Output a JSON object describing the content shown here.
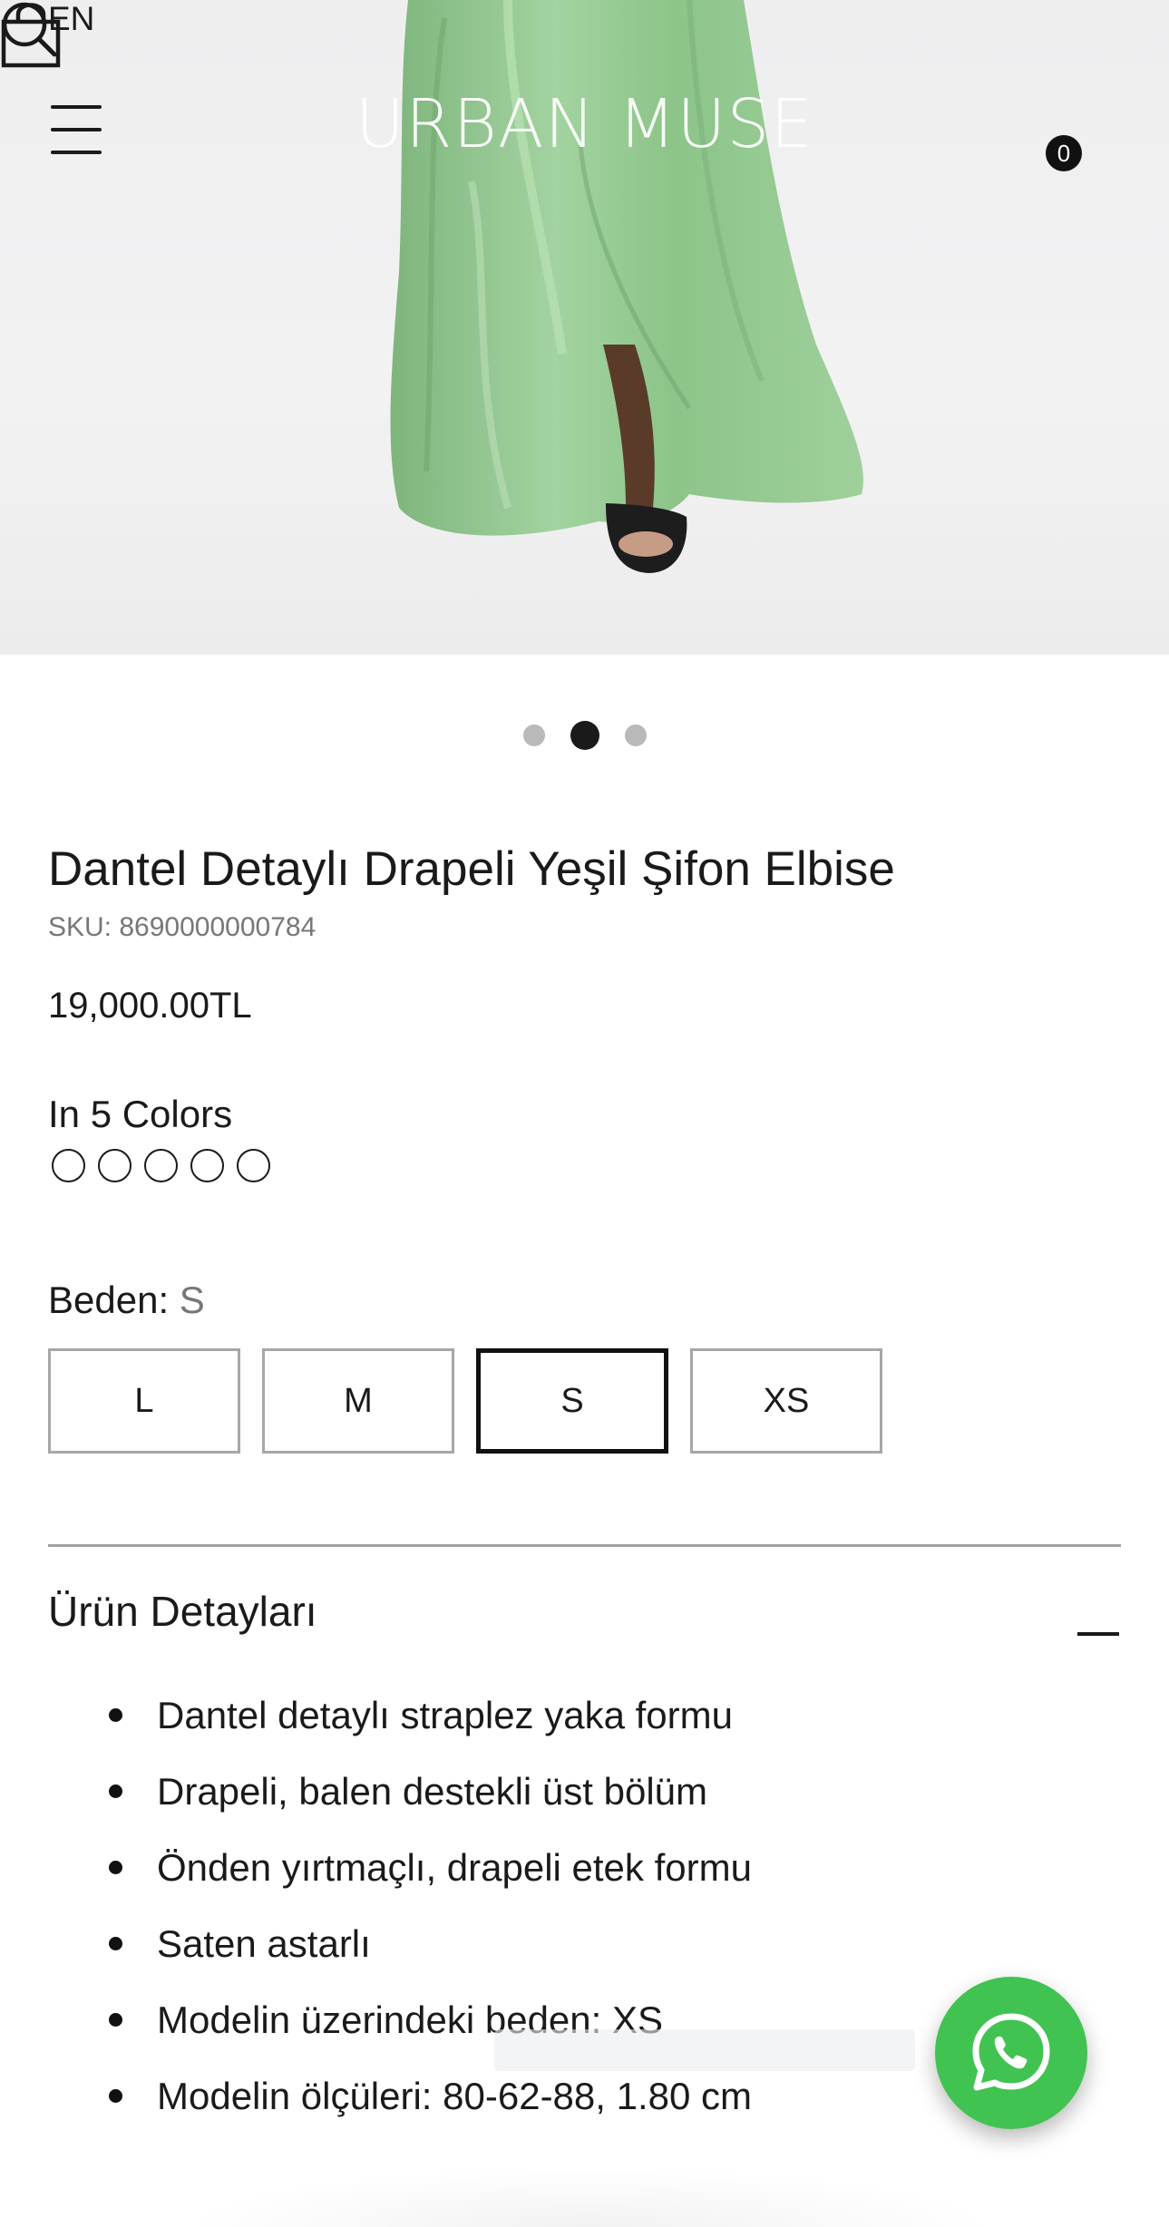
{
  "header": {
    "language": "EN",
    "brand": "URBAN MUSE",
    "cart_count": "0",
    "icons": {
      "menu": "hamburger-icon",
      "search": "search-icon",
      "cart": "shopping-bag-icon"
    }
  },
  "gallery": {
    "image_count": 3,
    "active_index": 1
  },
  "product": {
    "title": "Dantel Detaylı Drapeli Yeşil Şifon Elbise",
    "sku": "SKU: 8690000000784",
    "price": "19,000.00TL",
    "colors_label": "In 5 Colors",
    "color_swatch_count": 5,
    "size_label": "Beden:",
    "selected_size": "S",
    "sizes": [
      "L",
      "M",
      "S",
      "XS"
    ]
  },
  "details": {
    "heading": "Ürün Detayları",
    "items": [
      "Dantel detaylı straplez yaka formu",
      "Drapeli, balen destekli üst bölüm",
      "Önden yırtmaçlı, drapeli etek formu",
      "Saten astarlı",
      "Modelin üzerindeki beden: XS",
      "Modelin ölçüleri: 80-62-88, 1.80 cm"
    ]
  },
  "whatsapp": {
    "icon": "whatsapp-icon",
    "color": "#41c351"
  },
  "colors": {
    "dress": "#8ec48b",
    "text": "#1a1a1a",
    "muted": "#777777"
  }
}
